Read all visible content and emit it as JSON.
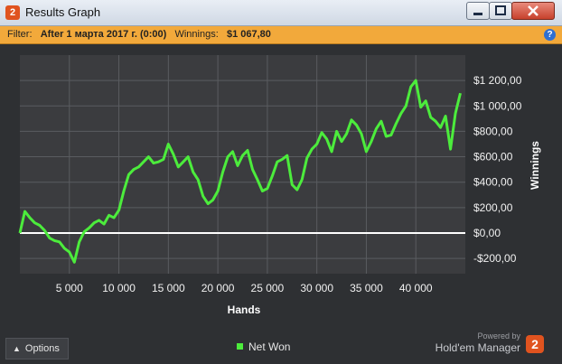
{
  "window": {
    "title": "Results Graph",
    "icon": "hm2-app-icon",
    "icon_text": "2",
    "buttons": [
      "minimize",
      "maximize",
      "close"
    ]
  },
  "filter_bar": {
    "filter_label": "Filter:",
    "filter_value": "After 1 марта 2017 г. (0:00)",
    "winnings_label": "Winnings:",
    "winnings_value": "$1 067,80",
    "help_icon": "question-icon",
    "help_text": "?"
  },
  "chart_data": {
    "type": "line",
    "xlabel": "Hands",
    "ylabel": "Winnings",
    "x_ticks": [
      "5 000",
      "10 000",
      "15 000",
      "20 000",
      "25 000",
      "30 000",
      "35 000",
      "40 000"
    ],
    "x_tick_values": [
      5000,
      10000,
      15000,
      20000,
      25000,
      30000,
      35000,
      40000
    ],
    "y_ticks": [
      "$1 200,00",
      "$1 000,00",
      "$800,00",
      "$600,00",
      "$400,00",
      "$200,00",
      "$0,00",
      "-$200,00"
    ],
    "y_tick_values": [
      1200,
      1000,
      800,
      600,
      400,
      200,
      0,
      -200
    ],
    "xlim": [
      0,
      45000
    ],
    "ylim": [
      -320,
      1400
    ],
    "grid": true,
    "legend_position": "bottom-center",
    "colors": {
      "series": "#4cec3c",
      "zero_line": "#ffffff",
      "grid": "#5a5c60",
      "background": "#3b3c3f"
    },
    "series": [
      {
        "name": "Net Won",
        "x": [
          0,
          500,
          1000,
          1500,
          2000,
          2500,
          3000,
          3500,
          4000,
          4500,
          5000,
          5500,
          6000,
          6500,
          7000,
          7500,
          8000,
          8500,
          9000,
          9500,
          10000,
          10500,
          11000,
          11500,
          12000,
          12500,
          13000,
          13500,
          14000,
          14500,
          15000,
          15500,
          16000,
          16500,
          17000,
          17500,
          18000,
          18500,
          19000,
          19500,
          20000,
          20500,
          21000,
          21500,
          22000,
          22500,
          23000,
          23500,
          24000,
          24500,
          25000,
          25500,
          26000,
          26500,
          27000,
          27500,
          28000,
          28500,
          29000,
          29500,
          30000,
          30500,
          31000,
          31500,
          32000,
          32500,
          33000,
          33500,
          34000,
          34500,
          35000,
          35500,
          36000,
          36500,
          37000,
          37500,
          38000,
          38500,
          39000,
          39500,
          40000,
          40500,
          41000,
          41500,
          42000,
          42500,
          43000,
          43500,
          44000,
          44500
        ],
        "y": [
          0,
          170,
          120,
          80,
          60,
          20,
          -40,
          -60,
          -70,
          -120,
          -150,
          -230,
          -70,
          10,
          40,
          80,
          100,
          70,
          140,
          120,
          180,
          330,
          460,
          500,
          520,
          560,
          600,
          550,
          560,
          580,
          700,
          620,
          520,
          560,
          600,
          480,
          420,
          290,
          230,
          260,
          330,
          480,
          600,
          640,
          530,
          610,
          650,
          500,
          420,
          330,
          350,
          450,
          560,
          580,
          610,
          380,
          340,
          420,
          590,
          660,
          700,
          790,
          740,
          640,
          800,
          720,
          780,
          890,
          850,
          780,
          640,
          720,
          820,
          880,
          760,
          770,
          860,
          940,
          1000,
          1150,
          1200,
          990,
          1040,
          910,
          880,
          830,
          920,
          660,
          940,
          1100
        ]
      }
    ]
  },
  "legend": {
    "label": "Net Won"
  },
  "options_button": {
    "label": "Options",
    "icon": "chevron-up-icon"
  },
  "branding": {
    "powered_by": "Powered by",
    "product": "Hold'em Manager",
    "logo_text": "2"
  }
}
